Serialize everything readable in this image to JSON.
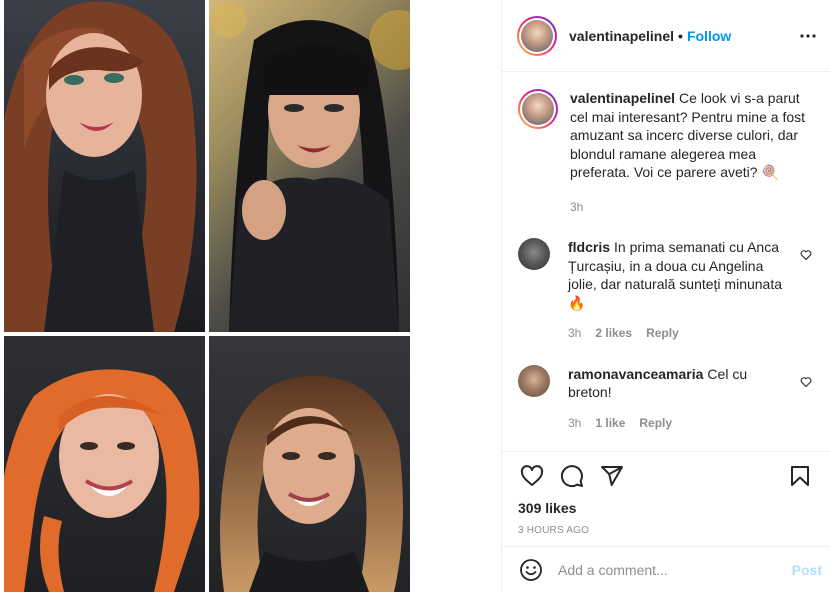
{
  "header": {
    "username": "valentinapelinel",
    "separator": "•",
    "follow_label": "Follow",
    "more_icon": "more-options-icon"
  },
  "caption": {
    "username": "valentinapelinel",
    "text": "Ce look vi s-a parut cel mai interesant? Pentru mine a fost amuzant sa incerc diverse culori, dar blondul ramane alegerea mea preferata. Voi ce parere aveti? 🍭",
    "time": "3h"
  },
  "comments": [
    {
      "username": "fldcris",
      "text": "In prima semanati cu Anca Țurcașiu, in a doua cu Angelina jolie, dar naturală sunteți minunata 🔥",
      "time": "3h",
      "likes": "2 likes",
      "reply": "Reply"
    },
    {
      "username": "ramonavanceamaria",
      "text": "Cel cu breton!",
      "time": "3h",
      "likes": "1 like",
      "reply": "Reply"
    }
  ],
  "actions": {
    "likes": "309 likes",
    "posted": "3 HOURS AGO"
  },
  "add_comment": {
    "placeholder": "Add a comment...",
    "post_label": "Post"
  },
  "colors": {
    "accent": "#0095f6",
    "post_disabled": "#b2dffc",
    "muted": "#8e8e8e",
    "text": "#262626",
    "border": "#efefef"
  }
}
